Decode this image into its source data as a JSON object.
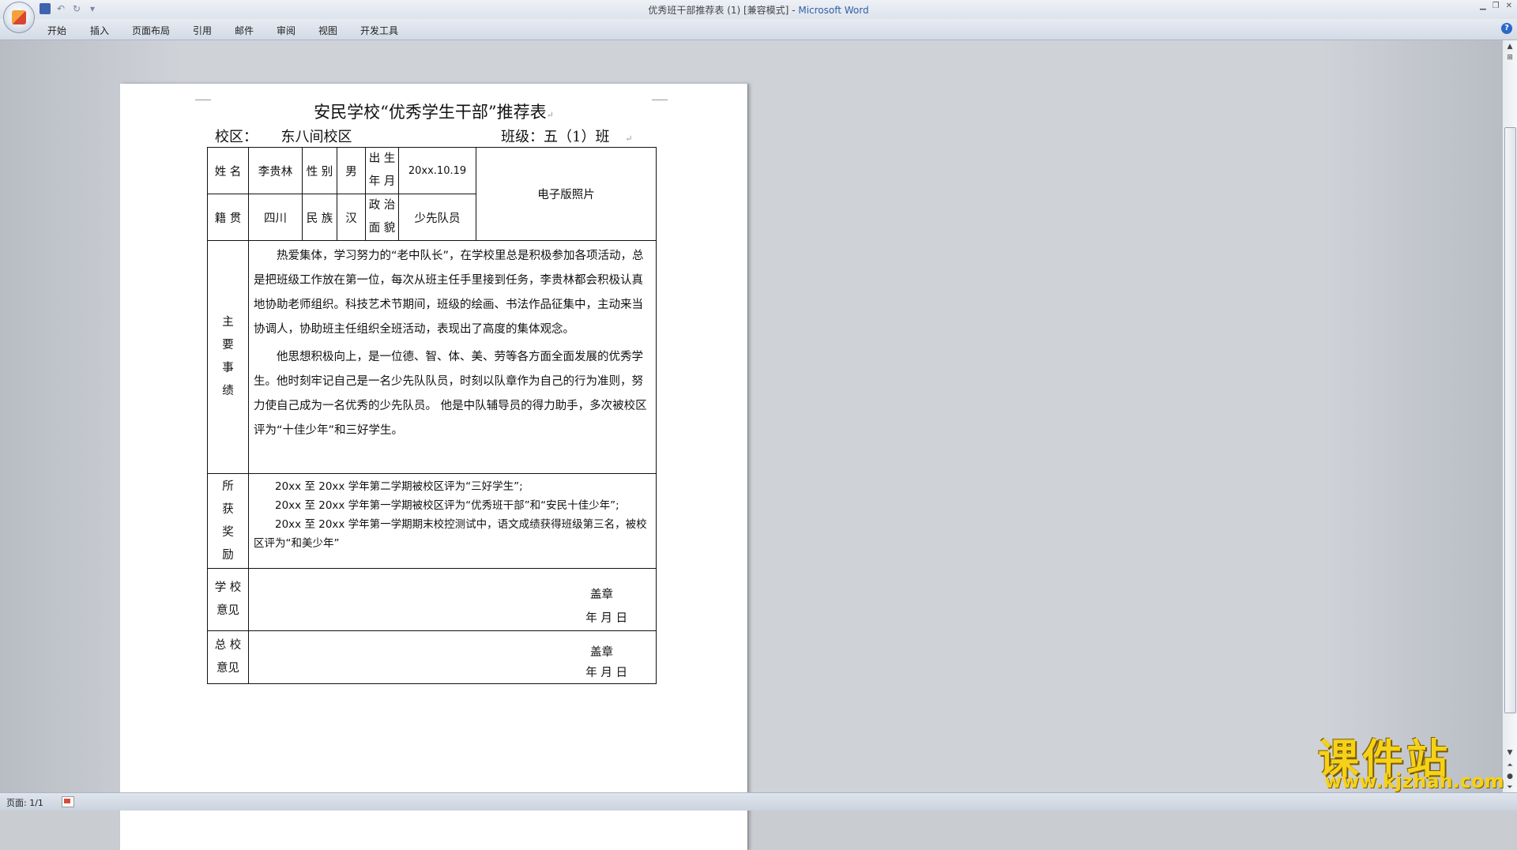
{
  "window": {
    "title": "优秀班干部推荐表 (1) [兼容模式]",
    "app_name": "Microsoft Word",
    "title_separator": " - "
  },
  "ribbon": {
    "tabs": [
      "开始",
      "插入",
      "页面布局",
      "引用",
      "邮件",
      "审阅",
      "视图",
      "开发工具"
    ]
  },
  "document": {
    "title": "安民学校“优秀学生干部”推荐表",
    "campus_label": "校区：",
    "campus_value": "东八间校区",
    "class_label": "班级：",
    "class_value": "五（1）班",
    "name_label": "姓  名",
    "name_value": "李贵林",
    "gender_label": "性 别",
    "gender_value": "男",
    "birth_label_1": "出 生",
    "birth_label_2": "年 月",
    "birth_value": "20xx.10.19",
    "photo_label": "电子版照片",
    "native_label": "籍  贯",
    "native_value": "四川",
    "ethnic_label": "民 族",
    "ethnic_value": "汉",
    "political_label_1": "政 治",
    "political_label_2": "面 貌",
    "political_value": "少先队员",
    "deeds_label": [
      "主",
      "要",
      "事",
      "绩"
    ],
    "deeds_paragraphs": [
      "热爱集体，学习努力的“老中队长”，在学校里总是积极参加各项活动，总是把班级工作放在第一位，每次从班主任手里接到任务，李贵林都会积极认真地协助老师组织。科技艺术节期间，班级的绘画、书法作品征集中，主动来当协调人，协助班主任组织全班活动，表现出了高度的集体观念。",
      "他思想积极向上，是一位德、智、体、美、劳等各方面全面发展的优秀学生。他时刻牢记自己是一名少先队队员，时刻以队章作为自己的行为准则，努力使自己成为一名优秀的少先队员。 他是中队辅导员的得力助手，多次被校区评为“十佳少年”和三好学生。"
    ],
    "awards_label": [
      "所",
      "获",
      "奖",
      "励"
    ],
    "awards_paragraphs": [
      "20xx 至 20xx 学年第二学期被校区评为“三好学生”;",
      "20xx 至 20xx 学年第一学期被校区评为“优秀班干部”和“安民十佳少年”;",
      "20xx 至 20xx 学年第一学期期末校控测试中，语文成绩获得班级第三名，被校区评为“和美少年”"
    ],
    "school_opinion_label_1": "学  校",
    "school_opinion_label_2": "意见",
    "head_opinion_label_1": "总  校",
    "head_opinion_label_2": "意见",
    "seal_text": "盖章",
    "date_text": "年    月    日",
    "para_mark": "↵"
  },
  "statusbar": {
    "page_count": "页面: 1/1"
  },
  "watermark": {
    "big": "课件站",
    "small": "www.kjzhan.com"
  },
  "colors": {
    "workspace": "#cfd2d7",
    "app_name": "#2f5fa8",
    "watermark": "#f5d218"
  }
}
